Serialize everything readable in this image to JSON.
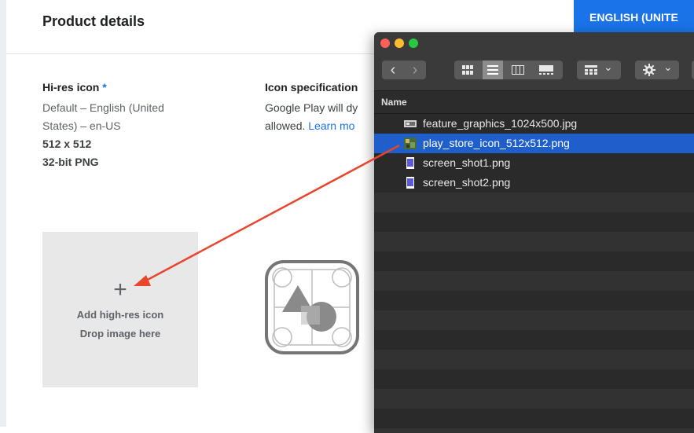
{
  "header": {
    "title": "Product details",
    "language_button": "ENGLISH (UNITE"
  },
  "hires": {
    "title": "Hi-res icon",
    "required_mark": "*",
    "lang_line1": "Default – English (United",
    "lang_line2": "States) – en-US",
    "size": "512 x 512",
    "format": "32-bit PNG"
  },
  "spec": {
    "title": "Icon specification",
    "line1": "Google Play will dy",
    "line2_prefix": "allowed. ",
    "learn_more": "Learn mo"
  },
  "drop_zone": {
    "plus": "+",
    "add_label": "Add high-res icon",
    "drop_label": "Drop image here"
  },
  "finder": {
    "column_header": "Name",
    "files": [
      {
        "name": "feature_graphics_1024x500.jpg",
        "icon": "landscape-image-icon",
        "selected": false
      },
      {
        "name": "play_store_icon_512x512.png",
        "icon": "image-thumbnail-icon",
        "selected": true
      },
      {
        "name": "screen_shot1.png",
        "icon": "phone-screenshot-icon",
        "selected": false
      },
      {
        "name": "screen_shot2.png",
        "icon": "phone-screenshot-icon",
        "selected": false
      }
    ],
    "toolbar": {
      "back": "‹",
      "forward": "›",
      "group_chevron": "⌄",
      "action_chevron": "⌄"
    }
  },
  "colors": {
    "accent_blue": "#1a73e8",
    "selection_blue": "#1f5fcc",
    "arrow_red": "#e8452c"
  }
}
